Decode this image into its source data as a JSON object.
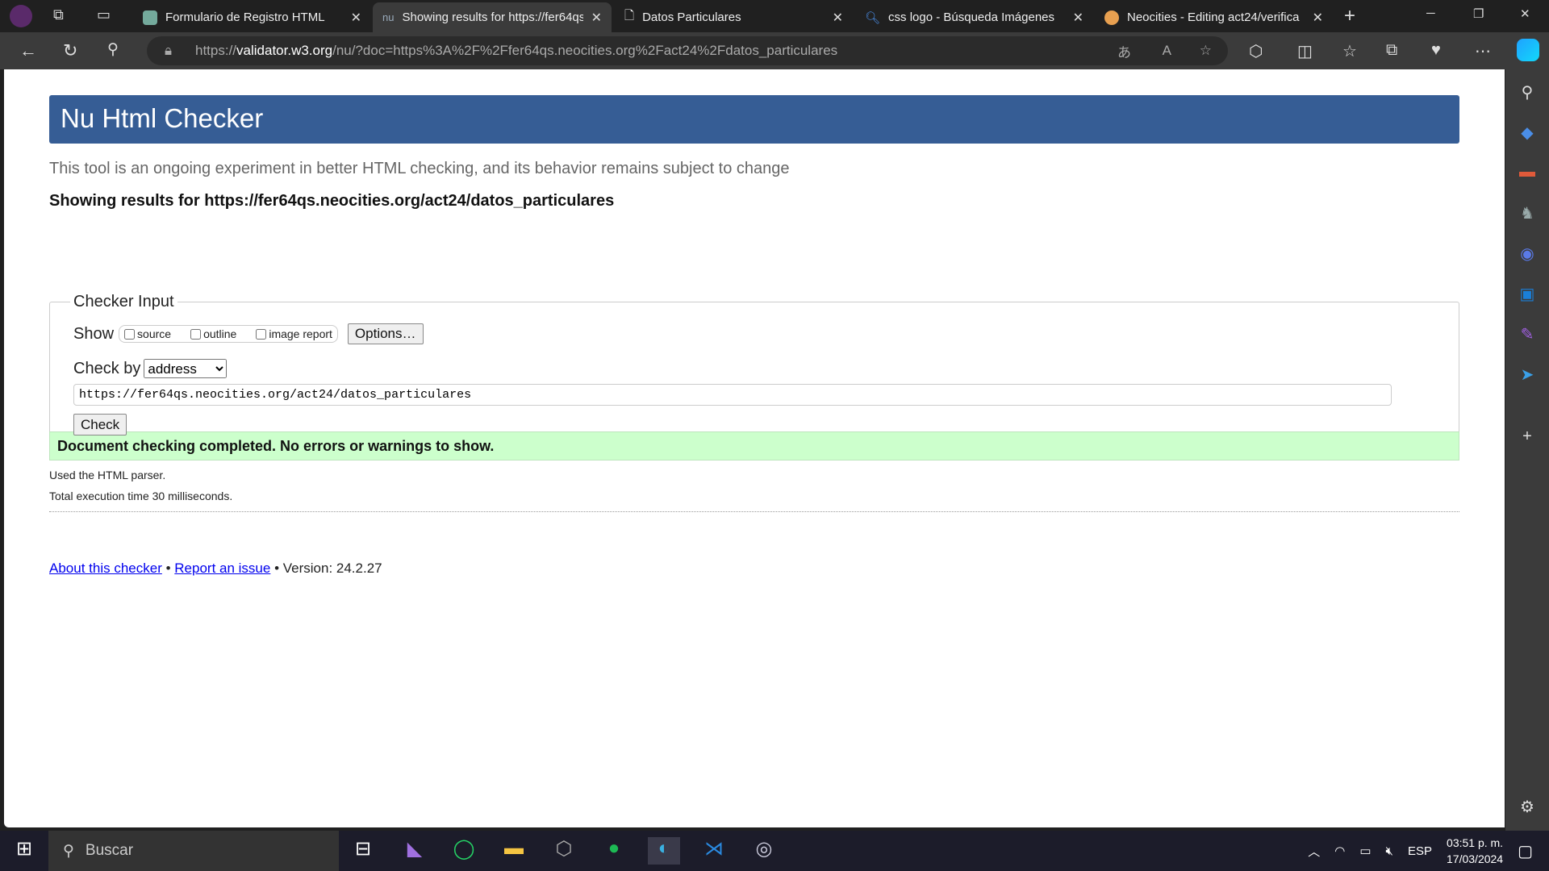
{
  "browser": {
    "tabs": [
      {
        "title": "Formulario de Registro HTML",
        "icon": "chatgpt-icon"
      },
      {
        "title": "Showing results for https://fer64qs",
        "icon": "nu-icon",
        "active": true
      },
      {
        "title": "Datos Particulares",
        "icon": "page-icon"
      },
      {
        "title": "css logo - Búsqueda Imágenes",
        "icon": "search-icon"
      },
      {
        "title": "Neocities - Editing act24/verifica",
        "icon": "neocities-icon"
      }
    ],
    "url_prefix": "https://",
    "url_domain": "validator.w3.org",
    "url_rest": "/nu/?doc=https%3A%2F%2Ffer64qs.neocities.org%2Fact24%2Fdatos_particulares"
  },
  "page": {
    "title": "Nu Html Checker",
    "intro": "This tool is an ongoing experiment in better HTML checking, and its behavior remains subject to change",
    "showing": "Showing results for https://fer64qs.neocities.org/act24/datos_particulares",
    "fieldset_legend": "Checker Input",
    "show_label": "Show",
    "options": [
      {
        "label": "source",
        "checked": false
      },
      {
        "label": "outline",
        "checked": false
      },
      {
        "label": "image report",
        "checked": false
      }
    ],
    "options_button": "Options…",
    "check_by_label": "Check by",
    "check_by_value": "address",
    "url_input": "https://fer64qs.neocities.org/act24/datos_particulares",
    "check_button": "Check",
    "result": "Document checking completed. No errors or warnings to show.",
    "parser": "Used the HTML parser.",
    "exec_time": "Total execution time 30 milliseconds.",
    "footer": {
      "about": "About this checker",
      "sep": " • ",
      "report": "Report an issue",
      "version": " • Version: 24.2.27"
    },
    "colors": {
      "header": "#365d95",
      "success": "#ccffcc"
    }
  },
  "taskbar": {
    "search_placeholder": "Buscar",
    "lang": "ESP",
    "time": "03:51 p. m.",
    "date": "17/03/2024"
  }
}
